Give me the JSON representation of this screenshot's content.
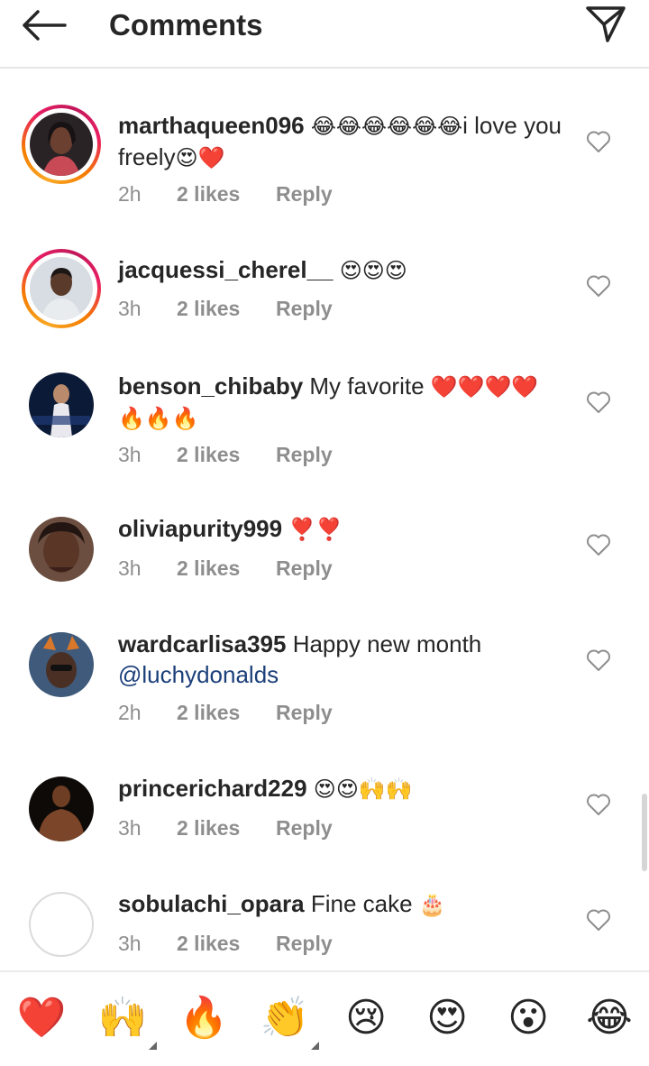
{
  "header": {
    "title": "Comments"
  },
  "comments": [
    {
      "username": "marthaqueen096",
      "text_before": " ",
      "emoji": "😂😂😂😂😂😂",
      "text_after": "i love you freely",
      "emoji2": "😍❤️",
      "time": "2h",
      "likes": "2 likes",
      "reply": "Reply",
      "mention": ""
    },
    {
      "username": "jacquessi_cherel__",
      "text_before": " ",
      "emoji": "😍😍😍",
      "text_after": "",
      "emoji2": "",
      "time": "3h",
      "likes": "2 likes",
      "reply": "Reply",
      "mention": ""
    },
    {
      "username": "benson_chibaby",
      "text_before": " My favorite ",
      "emoji": "❤️❤️❤️❤️ 🔥🔥🔥",
      "text_after": "",
      "emoji2": "",
      "time": "3h",
      "likes": "2 likes",
      "reply": "Reply",
      "mention": ""
    },
    {
      "username": "oliviapurity999",
      "text_before": " ",
      "emoji": "❣️❣️",
      "text_after": "",
      "emoji2": "",
      "time": "3h",
      "likes": "2 likes",
      "reply": "Reply",
      "mention": ""
    },
    {
      "username": "wardcarlisa395",
      "text_before": " Happy new month ",
      "emoji": "",
      "text_after": "",
      "emoji2": "",
      "mention": "@luchydonalds",
      "time": "2h",
      "likes": "2 likes",
      "reply": "Reply"
    },
    {
      "username": "princerichard229",
      "text_before": " ",
      "emoji": "😍😍🙌🙌",
      "text_after": "",
      "emoji2": "",
      "time": "3h",
      "likes": "2 likes",
      "reply": "Reply",
      "mention": ""
    },
    {
      "username": "sobulachi_opara",
      "text_before": " Fine cake ",
      "emoji": "🎂",
      "text_after": "",
      "emoji2": "",
      "time": "3h",
      "likes": "2 likes",
      "reply": "Reply",
      "mention": ""
    }
  ],
  "reactions": [
    {
      "emoji": "❤️",
      "name": "red-heart"
    },
    {
      "emoji": "🙌",
      "name": "raising-hands"
    },
    {
      "emoji": "🔥",
      "name": "fire"
    },
    {
      "emoji": "👏",
      "name": "clapping-hands"
    },
    {
      "emoji": "😢",
      "name": "crying-face"
    },
    {
      "emoji": "😍",
      "name": "heart-eyes"
    },
    {
      "emoji": "😮",
      "name": "surprised-face"
    },
    {
      "emoji": "😂",
      "name": "tears-of-joy"
    }
  ],
  "colors": {
    "text": "#262626",
    "secondary": "#8e8e8e",
    "mention": "#1b3f7a",
    "divider": "#e6e6e6"
  },
  "icons": {
    "back": "back-arrow-icon",
    "share": "direct-send-icon",
    "like": "heart-outline-icon"
  }
}
